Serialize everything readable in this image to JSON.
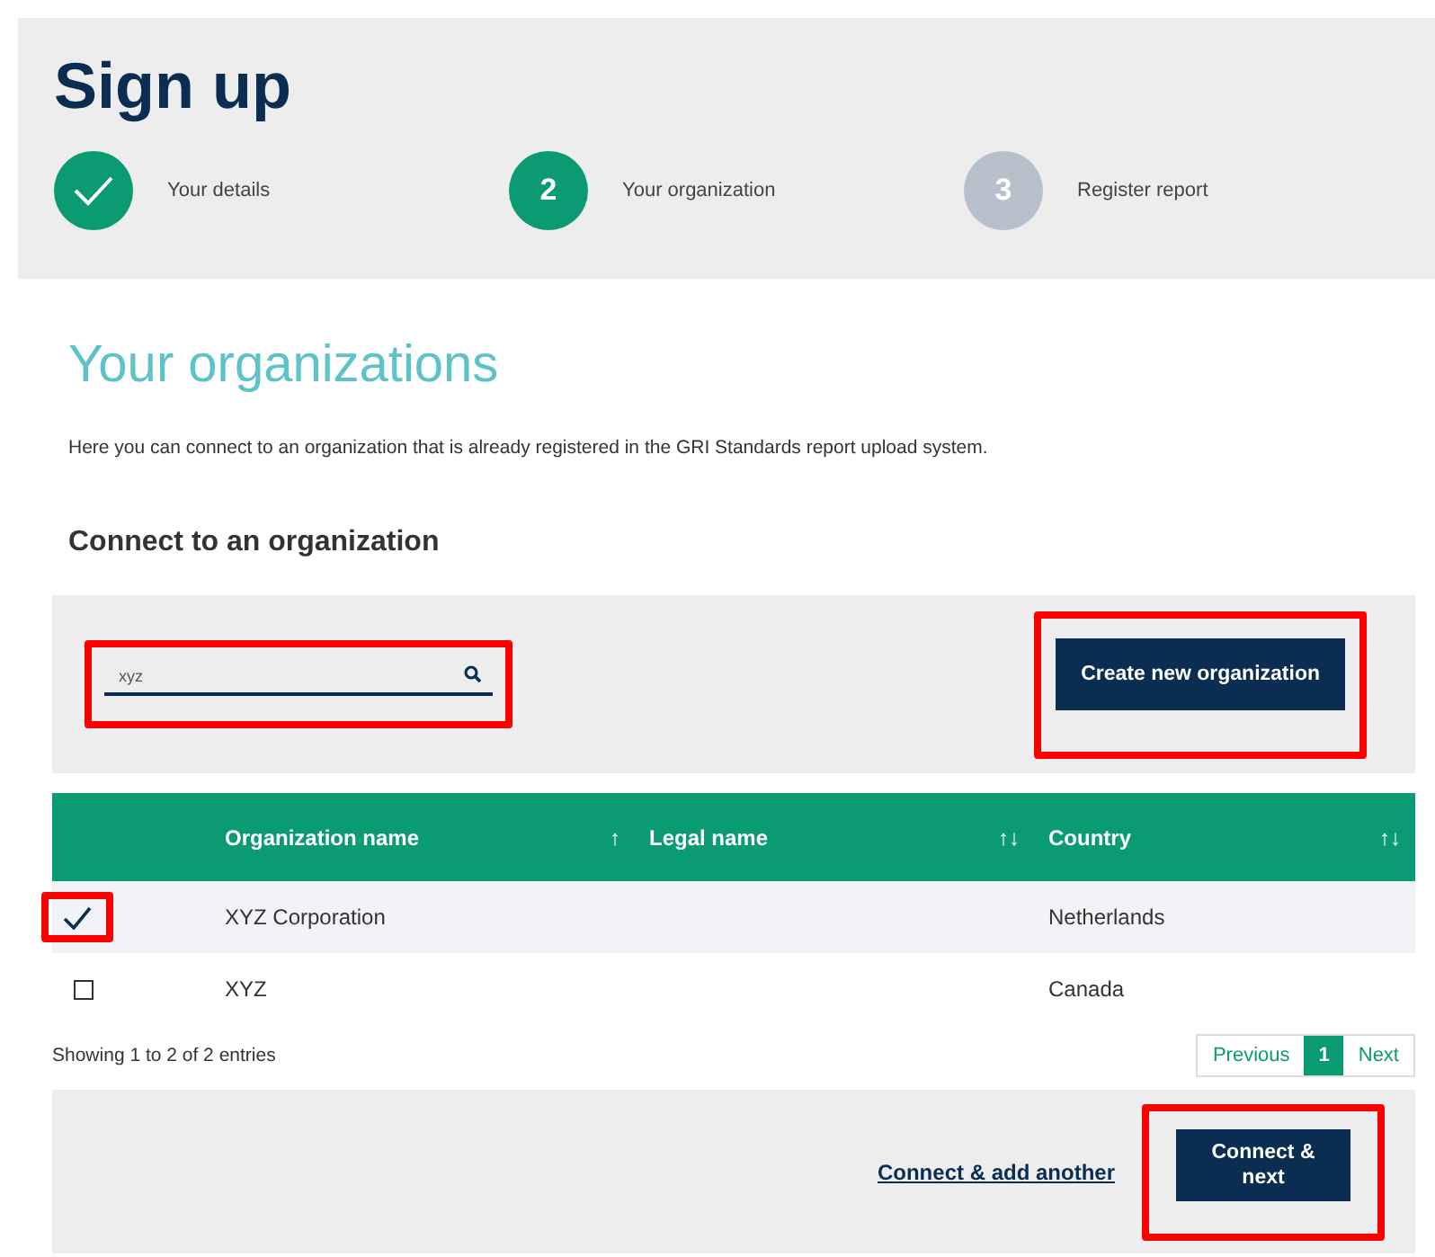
{
  "header": {
    "title": "Sign up",
    "steps": [
      {
        "label": "Your details",
        "completed": true,
        "selected": false
      },
      {
        "number": "2",
        "label": "Your organization",
        "completed": false,
        "selected": true
      },
      {
        "number": "3",
        "label": "Register report",
        "completed": false,
        "selected": false
      }
    ]
  },
  "heading": "Your organizations",
  "intro": "Here you can connect to an organization that is already registered in the GRI Standards report upload system.",
  "section_title": "Connect to an organization",
  "search": {
    "value": "xyz",
    "highlighted": true
  },
  "create_button": {
    "label": "Create new organization",
    "highlighted": true
  },
  "table": {
    "columns": [
      {
        "label": "Organization name",
        "sort": "↑"
      },
      {
        "label": "Legal name",
        "sort": "↑↓"
      },
      {
        "label": "Country",
        "sort": "↑↓"
      }
    ],
    "rows": [
      {
        "checked": true,
        "highlighted": true,
        "cells": [
          "XYZ Corporation",
          "",
          "Netherlands"
        ]
      },
      {
        "checked": false,
        "highlighted": false,
        "cells": [
          "XYZ",
          "",
          "Canada"
        ]
      }
    ]
  },
  "info": "Showing 1 to 2 of 2 entries",
  "pagination": {
    "previous": "Previous",
    "pages": [
      {
        "label": "1",
        "selected": true
      }
    ],
    "next": "Next"
  },
  "footer": {
    "link": "Connect & add another",
    "button": {
      "label": "Connect &\nnext",
      "highlighted": true
    }
  }
}
